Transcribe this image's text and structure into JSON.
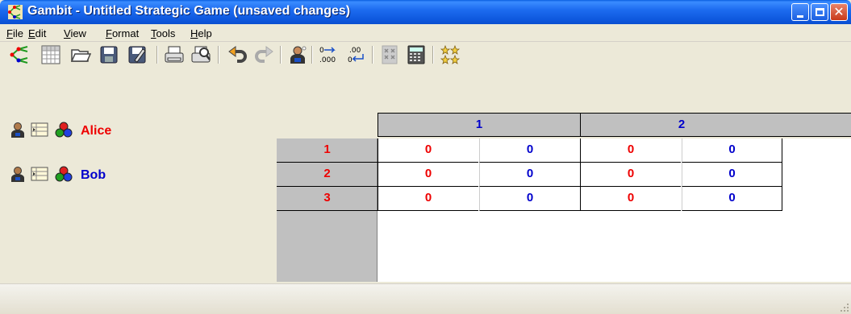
{
  "window": {
    "title": "Gambit - Untitled Strategic Game (unsaved changes)"
  },
  "menu": [
    "File",
    "Edit",
    "View",
    "Format",
    "Tools",
    "Help"
  ],
  "toolbar_icons": [
    "tree-icon",
    "new-table-icon",
    "open-folder-icon",
    "save-icon",
    "edit-icon",
    "print-icon",
    "print-preview-icon",
    "undo-icon",
    "redo-icon",
    "add-player-icon",
    "decimal-more-icon",
    "decimal-less-icon",
    "dominance-icon",
    "calculator-icon",
    "equilibrium-icon"
  ],
  "players": [
    {
      "name": "Alice",
      "color": "#ee0000"
    },
    {
      "name": "Bob",
      "color": "#0000cc"
    }
  ],
  "table": {
    "column_strategies": [
      "1",
      "2"
    ],
    "row_strategies": [
      "1",
      "2",
      "3"
    ],
    "payoffs": [
      [
        {
          "p1": "0",
          "p2": "0"
        },
        {
          "p1": "0",
          "p2": "0"
        }
      ],
      [
        {
          "p1": "0",
          "p2": "0"
        },
        {
          "p1": "0",
          "p2": "0"
        }
      ],
      [
        {
          "p1": "0",
          "p2": "0"
        },
        {
          "p1": "0",
          "p2": "0"
        }
      ]
    ]
  }
}
